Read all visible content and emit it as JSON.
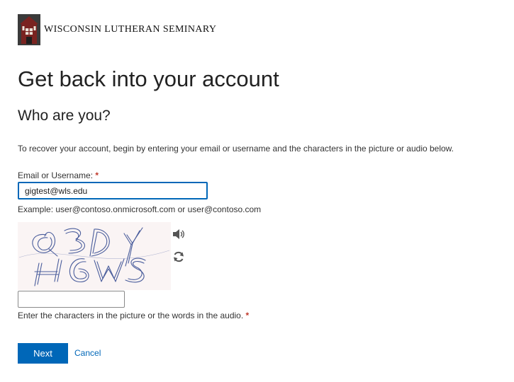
{
  "header": {
    "logo_icon": "seminary-chapel-logo",
    "org_name": "WISCONSIN LUTHERAN SEMINARY"
  },
  "page": {
    "title": "Get back into your account",
    "subtitle": "Who are you?",
    "intro": "To recover your account, begin by entering your email or username and the characters in the picture or audio below."
  },
  "form": {
    "email_label": "Email or Username:",
    "required_mark": "*",
    "email_value": "gigtest@wls.edu",
    "example": "Example: user@contoso.onmicrosoft.com or user@contoso.com",
    "captcha_hint": "Enter the characters in the picture or the words in the audio.",
    "captcha_icons": {
      "audio": "speaker-icon",
      "refresh": "refresh-icon"
    }
  },
  "actions": {
    "next_label": "Next",
    "cancel_label": "Cancel"
  },
  "colors": {
    "accent": "#0067b8",
    "required": "#c0392b",
    "logo_brick": "#7a2320"
  }
}
